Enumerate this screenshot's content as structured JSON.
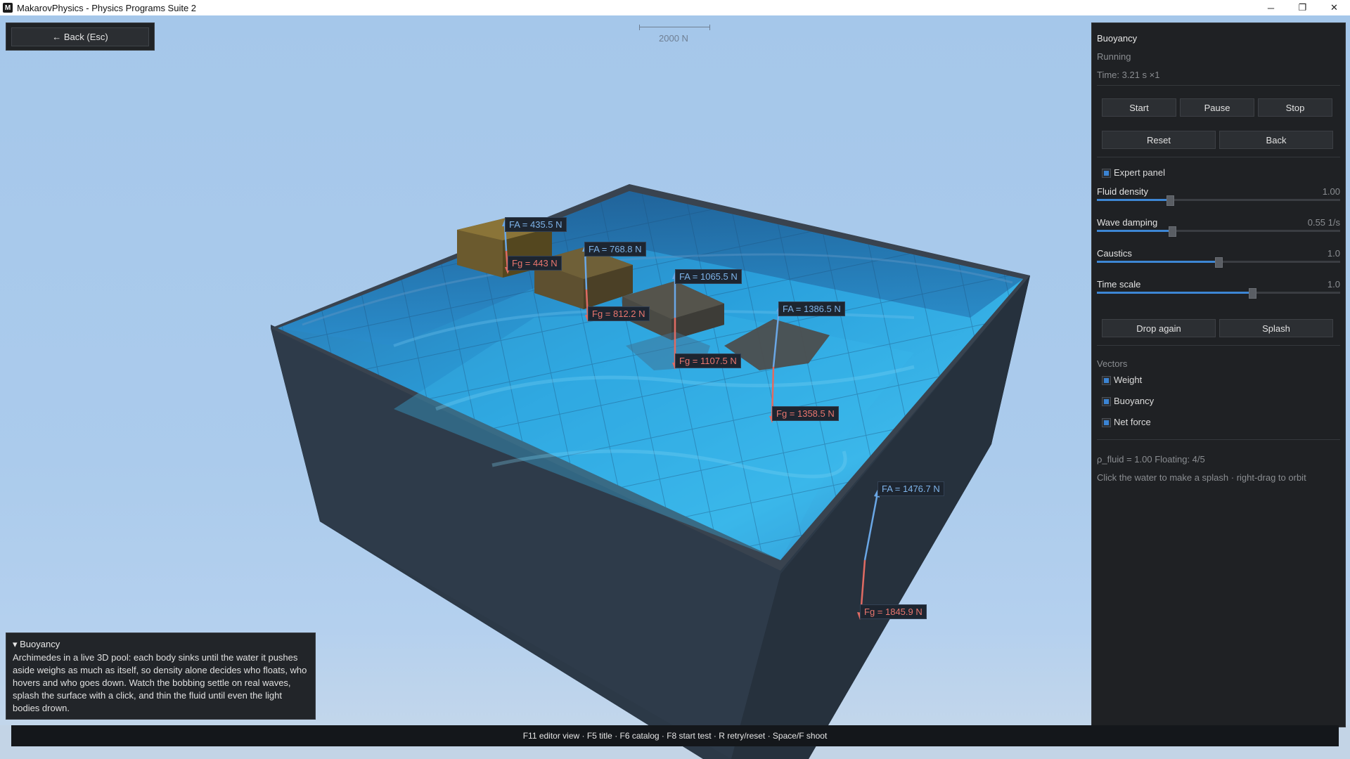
{
  "window": {
    "icon_letter": "M",
    "title": "MakarovPhysics - Physics Programs Suite 2",
    "minimize": "─",
    "restore": "❐",
    "close": "✕"
  },
  "toolbar": {
    "back_label": "←  Back  (Esc)"
  },
  "scale_bar": {
    "label": "2000 N"
  },
  "forces": [
    {
      "fa": "FA = 435.5 N",
      "fg": "Fg = 443 N"
    },
    {
      "fa": "FA = 768.8 N",
      "fg": "Fg = 812.2 N"
    },
    {
      "fa": "FA = 1065.5 N",
      "fg": "Fg = 1107.5 N"
    },
    {
      "fa": "FA = 1386.5 N",
      "fg": "Fg = 1358.5 N"
    },
    {
      "fa": "FA = 1476.7 N",
      "fg": "Fg = 1845.9 N"
    }
  ],
  "panel": {
    "title": "Buoyancy",
    "status": "Running",
    "time": "Time: 3.21 s   ×1",
    "buttons": {
      "start": "Start",
      "pause": "Pause",
      "stop": "Stop",
      "reset": "Reset",
      "back": "Back",
      "drop_again": "Drop again",
      "splash": "Splash"
    },
    "expert_panel": {
      "label": "Expert panel",
      "checked": true
    },
    "sliders": [
      {
        "label": "Fluid density",
        "value": "1.00",
        "fraction": 0.3
      },
      {
        "label": "Wave damping",
        "value": "0.55 1/s",
        "fraction": 0.31
      },
      {
        "label": "Caustics",
        "value": "1.0",
        "fraction": 0.5
      },
      {
        "label": "Time scale",
        "value": "1.0",
        "fraction": 0.64
      }
    ],
    "vectors": {
      "heading": "Vectors",
      "items": [
        {
          "label": "Weight",
          "checked": true
        },
        {
          "label": "Buoyancy",
          "checked": true
        },
        {
          "label": "Net force",
          "checked": true
        }
      ]
    },
    "info": "ρ_fluid = 1.00   Floating: 4/5",
    "hint": "Click the water to make a splash · right-drag to orbit"
  },
  "description": {
    "title": "▾ Buoyancy",
    "text": "Archimedes in a live 3D pool: each body sinks until the water it pushes aside weighs as much as itself, so density alone decides who floats, who hovers and who goes down. Watch the bobbing settle on real waves, splash the surface with a click, and thin the fluid until even the light bodies drown."
  },
  "statusbar": {
    "text": "F11 editor view · F5 title · F6 catalog · F8 start test · R retry/reset · Space/F shoot"
  },
  "colors": {
    "fa_arrow": "#6aa7e6",
    "fg_arrow": "#e06b63",
    "accent": "#3d86d4",
    "water": "#2e9bd6"
  }
}
